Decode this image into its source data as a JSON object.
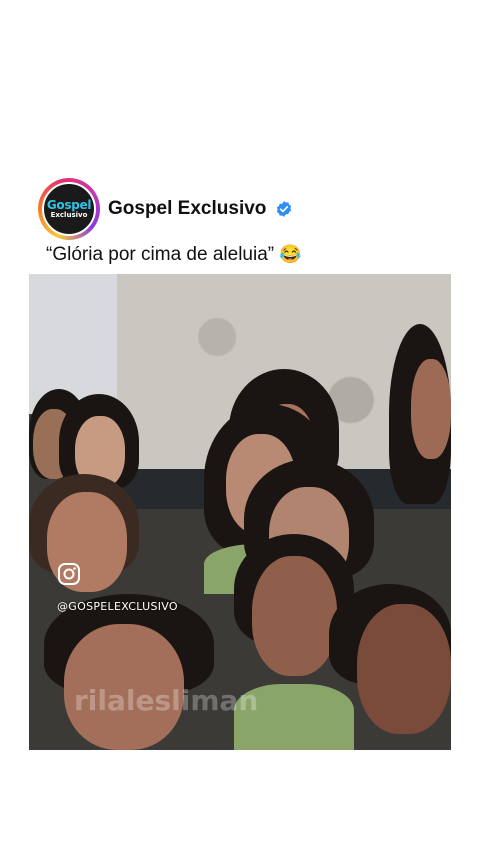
{
  "post": {
    "account_name": "Gospel Exclusivo",
    "verified": true,
    "caption": "“Glória por cima de aleluia”",
    "caption_emoji": "😂",
    "avatar": {
      "line1": "Gospel",
      "line2": "Exclusivo"
    }
  },
  "video": {
    "overlay_handle": "@GOSPELEXCLUSIVO",
    "overlay_icon": "instagram-icon",
    "faded_watermark": "rilalesliman"
  },
  "colors": {
    "verified_blue": "#2f8ef5",
    "avatar_ring": "#e6316d",
    "avatar_text": "#2ec4e6"
  }
}
